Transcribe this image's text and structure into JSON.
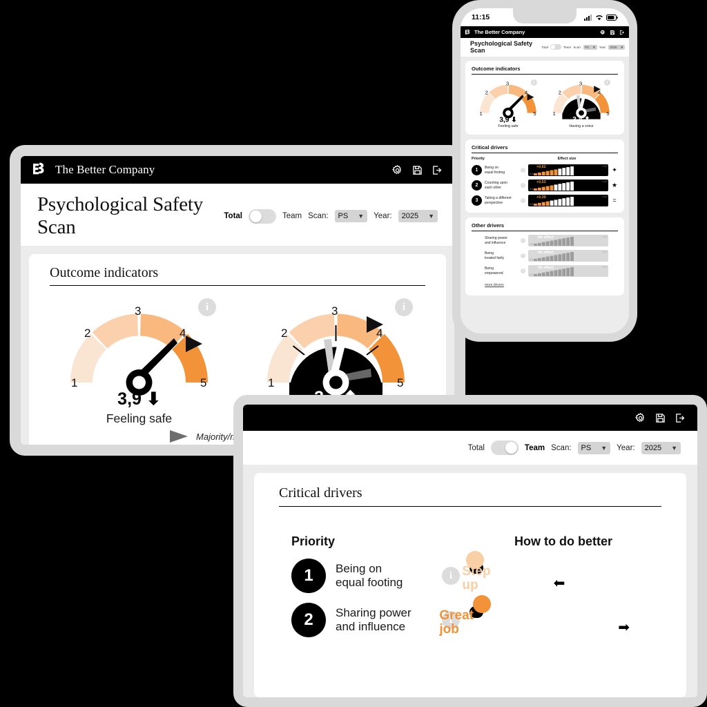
{
  "brand": {
    "name": "The Better Company",
    "logo_icon": "eb-monogram-logo"
  },
  "topbar_icons": [
    {
      "name": "settings-gear-icon",
      "label": "Settings"
    },
    {
      "name": "save-floppy-icon",
      "label": "Save"
    },
    {
      "name": "logout-icon",
      "label": "Log out"
    }
  ],
  "desktop": {
    "page_title": "Psychological Safety Scan",
    "controls": {
      "toggle_left_label": "Total",
      "toggle_right_label": "Team",
      "toggle_position": "left",
      "scan_label": "Scan:",
      "scan_value": "PS",
      "year_label": "Year:",
      "year_value": "2025"
    },
    "card_title": "Outcome indicators",
    "legend": "Majority/minority gap",
    "info_badge": "i"
  },
  "tablet": {
    "controls": {
      "toggle_left_label": "Total",
      "toggle_right_label": "Team",
      "toggle_position": "right",
      "scan_label": "Scan:",
      "scan_value": "PS",
      "year_label": "Year:",
      "year_value": "2025"
    },
    "card_title": "Critical drivers",
    "col_priority": "Priority",
    "col_how": "How to do better",
    "rows": [
      {
        "rank": "1",
        "label": "Being on\nequal footing",
        "info": "i",
        "step_label": "Step up",
        "step_index": 1,
        "steps": 4,
        "arrow": "left",
        "accent": "#f9cfa6"
      },
      {
        "rank": "2",
        "label": "Sharing power\nand influence",
        "info": "i",
        "step_label": "Great job",
        "step_index": 3,
        "steps": 4,
        "arrow": "right",
        "accent": "#f2933a"
      }
    ]
  },
  "phone": {
    "status": {
      "time": "11:15",
      "signal_icon": "cellular-signal-icon",
      "wifi_icon": "wifi-icon",
      "battery_icon": "battery-icon"
    },
    "page_title": "Psychological Safety Scan",
    "controls": {
      "toggle_left_label": "Total",
      "toggle_right_label": "Team",
      "toggle_position": "left",
      "scan_label": "Scan:",
      "scan_value": "PS",
      "year_label": "Year:",
      "year_value": "2025"
    },
    "outcome_title": "Outcome indicators",
    "critical_title": "Critical drivers",
    "other_title": "Other drivers",
    "col_priority": "Priority",
    "col_effect": "Effect size",
    "critical_rows": [
      {
        "rank": "1",
        "label": "Being on\nequal footing",
        "value": "+0,62",
        "min": "0,0",
        "max": "+1,0",
        "fill": 0.62,
        "symbol": "✦"
      },
      {
        "rank": "2",
        "label": "Counting upon\neach other",
        "value": "+0,53",
        "min": "0,0",
        "max": "+1,0",
        "fill": 0.53,
        "symbol": "★"
      },
      {
        "rank": "3",
        "label": "Taking a different\nperspective",
        "value": "+0,39",
        "min": "0,0",
        "max": "+1,0",
        "fill": 0.39,
        "symbol": "="
      }
    ],
    "other_rows": [
      {
        "label": "Sharing power\nand influence",
        "value": "No effect",
        "min": "0,0",
        "max": "+1,0",
        "fill": 0.0
      },
      {
        "label": "Being\ntreated fairly",
        "value": "No effect",
        "min": "0,0",
        "max": "+1,0",
        "fill": 0.0
      },
      {
        "label": "Being\nempowered",
        "value": "No effect",
        "min": "0,0",
        "max": "+1,0",
        "fill": 0.0
      }
    ],
    "more_link": "more drivers"
  },
  "chart_data": [
    {
      "type": "gauge",
      "title": "Feeling safe",
      "value": 3.9,
      "value_label": "3,9",
      "trend": "down",
      "scale_min": 1,
      "scale_max": 5,
      "tick_labels": [
        "1",
        "2",
        "3",
        "4",
        "5"
      ],
      "band_colors": [
        "#fae4d2",
        "#fbd0ad",
        "#f9b87e",
        "#f2933a"
      ],
      "majority_marker": 4.25,
      "selected": false
    },
    {
      "type": "gauge",
      "title": "Having a voice",
      "value": 3.4,
      "value_label": "3,4",
      "trend": "up",
      "scale_min": 1,
      "scale_max": 5,
      "tick_labels": [
        "1",
        "2",
        "3",
        "4",
        "5"
      ],
      "band_colors": [
        "#fae4d2",
        "#fbd0ad",
        "#f9b87e",
        "#f2933a"
      ],
      "majority_marker": 4.1,
      "minority_needle": 3.0,
      "majority_needle": 4.35,
      "selected": true
    },
    {
      "type": "bar",
      "title": "Critical drivers — Effect size",
      "categories": [
        "Being on equal footing",
        "Counting upon each other",
        "Taking a different perspective"
      ],
      "values": [
        0.62,
        0.53,
        0.39
      ],
      "value_labels": [
        "+0,62",
        "+0,53",
        "+0,39"
      ],
      "xlabel": "Effect size",
      "ylabel": "",
      "xlim": [
        0.0,
        1.0
      ]
    },
    {
      "type": "bar",
      "title": "Other drivers — Effect size",
      "categories": [
        "Sharing power and influence",
        "Being treated fairly",
        "Being empowered"
      ],
      "values": [
        0,
        0,
        0
      ],
      "value_labels": [
        "No effect",
        "No effect",
        "No effect"
      ],
      "xlabel": "Effect size",
      "ylabel": "",
      "xlim": [
        0.0,
        1.0
      ]
    }
  ],
  "colors": {
    "accent_orange": "#f2933a",
    "accent_light": "#f9cfa6",
    "band_1": "#fae4d2",
    "band_2": "#fbd0ad",
    "band_3": "#f9b87e",
    "band_4": "#f2933a",
    "black": "#000000",
    "frame_grey": "#d9d9d9",
    "page_bg": "#ececec"
  }
}
